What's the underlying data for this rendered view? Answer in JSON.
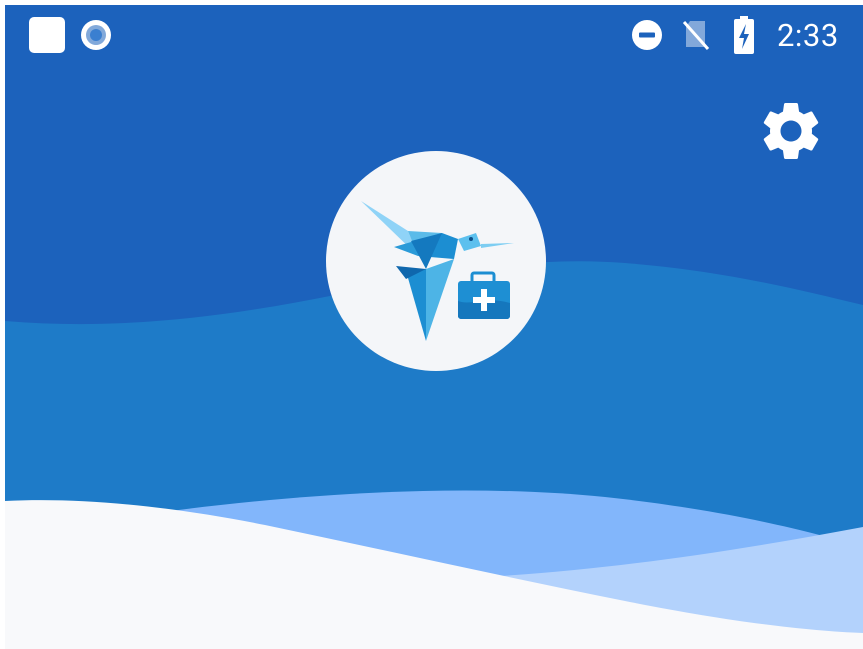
{
  "status_bar": {
    "time": "2:33",
    "left_icons": [
      "app-square-icon",
      "screen-record-icon"
    ],
    "right_icons": [
      "do-not-disturb-icon",
      "no-sim-icon",
      "battery-charging-icon"
    ]
  },
  "header": {
    "settings_icon": "gear-icon"
  },
  "logo": {
    "icon": "hummingbird-medical-kit-icon"
  },
  "colors": {
    "background_top": "#1c62bc",
    "wave_mid": "#1e7bc8",
    "wave_light": "#82b6fb",
    "wave_lighter": "#b3d2fc",
    "wave_white": "#f8f9fb",
    "logo_circle": "#f4f6f9"
  }
}
